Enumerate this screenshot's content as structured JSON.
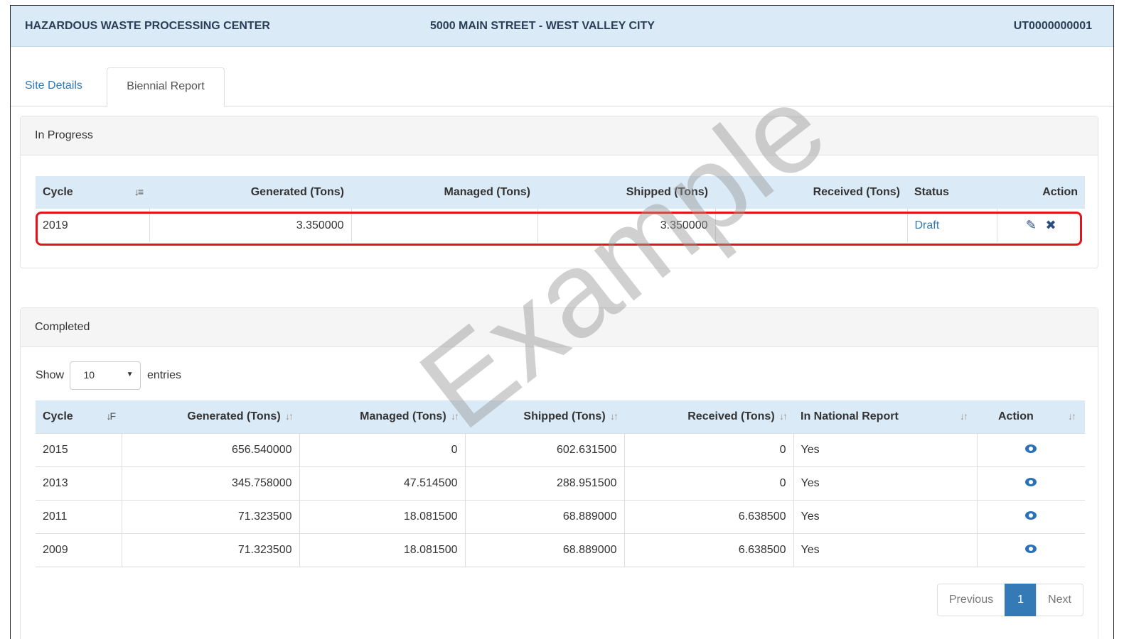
{
  "header": {
    "site_name": "HAZARDOUS WASTE PROCESSING CENTER",
    "address": "5000 MAIN STREET - WEST VALLEY CITY",
    "site_id": "UT0000000001"
  },
  "tabs": [
    {
      "label": "Site Details",
      "active": false
    },
    {
      "label": "Biennial Report",
      "active": true
    }
  ],
  "in_progress": {
    "heading": "In Progress",
    "columns": [
      "Cycle",
      "Generated (Tons)",
      "Managed (Tons)",
      "Shipped (Tons)",
      "Received (Tons)",
      "Status",
      "Action"
    ],
    "rows": [
      {
        "cycle": "2019",
        "generated": "3.350000",
        "managed": "",
        "shipped": "3.350000",
        "received": "",
        "status": "Draft"
      }
    ]
  },
  "completed": {
    "heading": "Completed",
    "show_label": "Show",
    "entries_value": "10",
    "entries_label": "entries",
    "columns": [
      "Cycle",
      "Generated (Tons)",
      "Managed (Tons)",
      "Shipped (Tons)",
      "Received (Tons)",
      "In National Report",
      "Action"
    ],
    "rows": [
      {
        "cycle": "2015",
        "generated": "656.540000",
        "managed": "0",
        "shipped": "602.631500",
        "received": "0",
        "national": "Yes"
      },
      {
        "cycle": "2013",
        "generated": "345.758000",
        "managed": "47.514500",
        "shipped": "288.951500",
        "received": "0",
        "national": "Yes"
      },
      {
        "cycle": "2011",
        "generated": "71.323500",
        "managed": "18.081500",
        "shipped": "68.889000",
        "received": "6.638500",
        "national": "Yes"
      },
      {
        "cycle": "2009",
        "generated": "71.323500",
        "managed": "18.081500",
        "shipped": "68.889000",
        "received": "6.638500",
        "national": "Yes"
      }
    ],
    "pagination": {
      "previous": "Previous",
      "current": "1",
      "next": "Next"
    }
  },
  "watermark": "Example",
  "colors": {
    "header_bg": "#dbeaf7",
    "link": "#337ab7",
    "highlight": "#e5131a"
  },
  "icons": {
    "edit": "pencil-icon",
    "delete": "times-icon",
    "view": "eye-icon",
    "sort": "sort-icon"
  }
}
